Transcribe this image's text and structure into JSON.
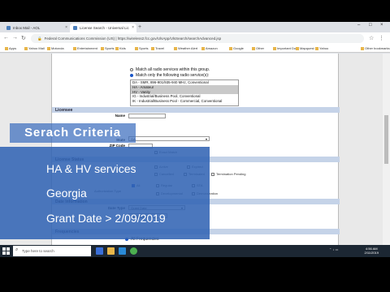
{
  "browser": {
    "tabs": [
      {
        "label": "Inbox Mail - AOL",
        "active": false
      },
      {
        "label": "License Search - Universal Lic",
        "active": true
      }
    ],
    "url": "Federal Communications Commission (US) | https://wireless2.fcc.gov/UlsApp/UlsSearch/searchAdvanced.jsp",
    "bookmarks": [
      "Apps",
      "Yahoo Mail",
      "Motorola",
      "Entertainment",
      "Sports",
      "Kids",
      "Sports",
      "Travel",
      "Weather Alert",
      "Amazon",
      "Google",
      "Other",
      "Important Docs",
      "Mapquest",
      "Yahoo",
      "Other bookmarks"
    ]
  },
  "form": {
    "radio_all": "Match all radio services within this group.",
    "radio_following": "Match only the following radio service(s):",
    "services": [
      {
        "text": "DA - SMR, 896-901/935-940 MHz, Conventional",
        "selected": false
      },
      {
        "text": "HA - Amateur",
        "selected": true
      },
      {
        "text": "HV - Vanity",
        "selected": true
      },
      {
        "text": "IG - Industrial/Business Pool, Conventional",
        "selected": false
      },
      {
        "text": "IK - Industrial/Business Pool - Commercial, Conventional",
        "selected": false
      }
    ],
    "licensee_section": "Licensee",
    "name_label": "Name",
    "state_label": "State",
    "state_value": "GA",
    "zip_label": "ZIP Code",
    "exact_match": "Exact Match",
    "license_section": "License Status",
    "status_options": [
      "Active",
      "Expired",
      "Cancelled",
      "Terminated",
      "Termination Pending"
    ],
    "all_label": "All",
    "auth_options": [
      "Regular",
      "STA"
    ],
    "authorization_type_label": "Authorization Type",
    "developmental_label": "Developmental",
    "demonstration_label": "Demonstration",
    "date_section": "Date Information",
    "date_type_label": "Date Type",
    "date_type_value": "Grant Date",
    "date_from": "02/09/2019",
    "freq_section": "Frequencies",
    "all_frequencies": "All Frequencies"
  },
  "overlay": {
    "title": "Serach Criteria",
    "lines": [
      "HA & HV services",
      "Georgia",
      "Grant Date > 2/09/2019"
    ]
  },
  "taskbar": {
    "search_placeholder": "Type here to search",
    "time": "4:56 AM",
    "date": "2/11/2019"
  }
}
